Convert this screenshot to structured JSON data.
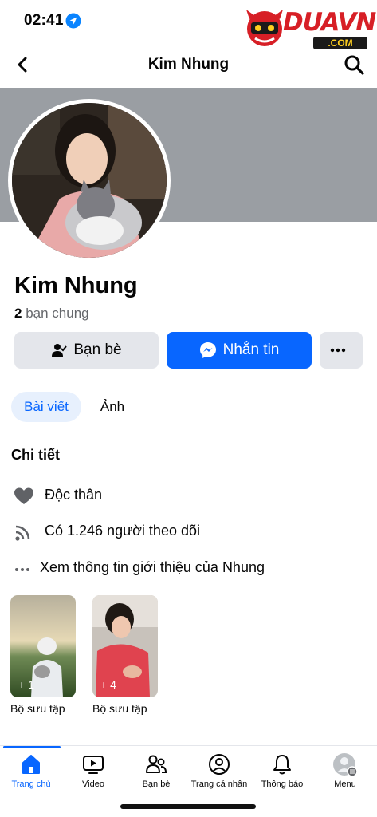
{
  "status_bar": {
    "time": "02:41"
  },
  "watermark": {
    "brand": "DUAVN",
    "domain": ".COM"
  },
  "header": {
    "title": "Kim Nhung"
  },
  "profile": {
    "name": "Kim Nhung",
    "mutual_count": "2",
    "mutual_label": "bạn chung"
  },
  "actions": {
    "friends_label": "Bạn bè",
    "message_label": "Nhắn tin"
  },
  "tabs": [
    {
      "label": "Bài viết",
      "active": true
    },
    {
      "label": "Ảnh",
      "active": false
    }
  ],
  "details": {
    "title": "Chi tiết",
    "items": [
      {
        "icon": "heart-icon",
        "text": "Độc thân"
      },
      {
        "icon": "rss-icon",
        "text": "Có 1.246 người theo dõi"
      },
      {
        "icon": "more-dots-icon",
        "text": "Xem thông tin giới thiệu của Nhung"
      }
    ]
  },
  "collections": [
    {
      "count": "+ 1",
      "label": "Bộ sưu tập"
    },
    {
      "count": "+ 4",
      "label": "Bộ sưu tập"
    }
  ],
  "bottom_nav": [
    {
      "label": "Trang chủ",
      "icon": "home-icon",
      "active": true
    },
    {
      "label": "Video",
      "icon": "video-icon",
      "active": false
    },
    {
      "label": "Bạn bè",
      "icon": "friends-icon",
      "active": false
    },
    {
      "label": "Trang cá nhân",
      "icon": "profile-icon",
      "active": false
    },
    {
      "label": "Thông báo",
      "icon": "bell-icon",
      "active": false
    },
    {
      "label": "Menu",
      "icon": "menu-avatar-icon",
      "active": false
    }
  ],
  "colors": {
    "accent": "#0866ff",
    "button_gray": "#e4e6eb",
    "cover_gray": "#9a9ea3",
    "secondary_text": "#65676b"
  }
}
